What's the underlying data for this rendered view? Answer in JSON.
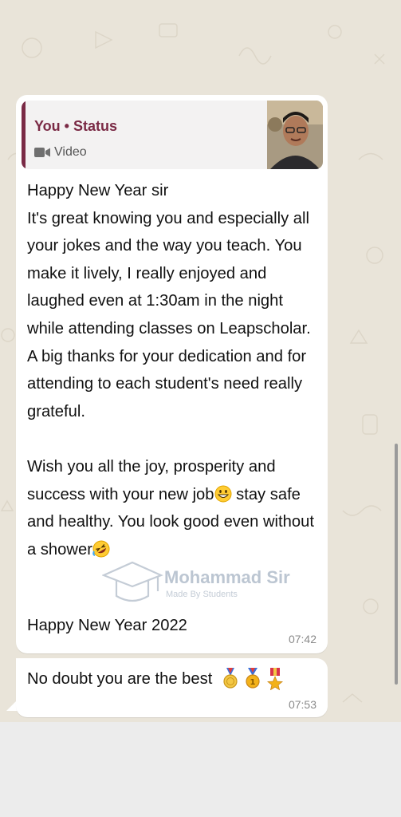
{
  "quote": {
    "title": "You • Status",
    "type_label": "Video"
  },
  "message1": {
    "line_greeting": "Happy New Year sir",
    "paragraph1": "It's great knowing you and especially all your jokes and the way you teach. You make it lively, I really enjoyed and laughed even at 1:30am in the night while attending classes on Leapscholar. A big thanks for your dedication and for attending to each student's need really grateful.",
    "paragraph2_part1": "Wish you all the joy, prosperity and success with your new job",
    "paragraph2_part2": " stay safe and healthy. You look good even without a shower",
    "closing": "Happy New Year 2022",
    "time": "07:42"
  },
  "watermark": {
    "title": "Mohammad Sir",
    "subtitle": "Made By Students"
  },
  "message2": {
    "text": "No doubt you are the best",
    "time": "07:53"
  },
  "icons": {
    "video": "video-camera-icon",
    "grin": "grinning-emoji",
    "rofl": "rolling-laughing-emoji",
    "medals": [
      "sports-medal-icon",
      "first-place-medal-icon",
      "military-medal-icon"
    ]
  },
  "colors": {
    "chat_background": "#E9E4D9",
    "bubble": "#FFFFFF",
    "quote_accent": "#7A2A45",
    "timestamp": "#8A8A8A"
  }
}
